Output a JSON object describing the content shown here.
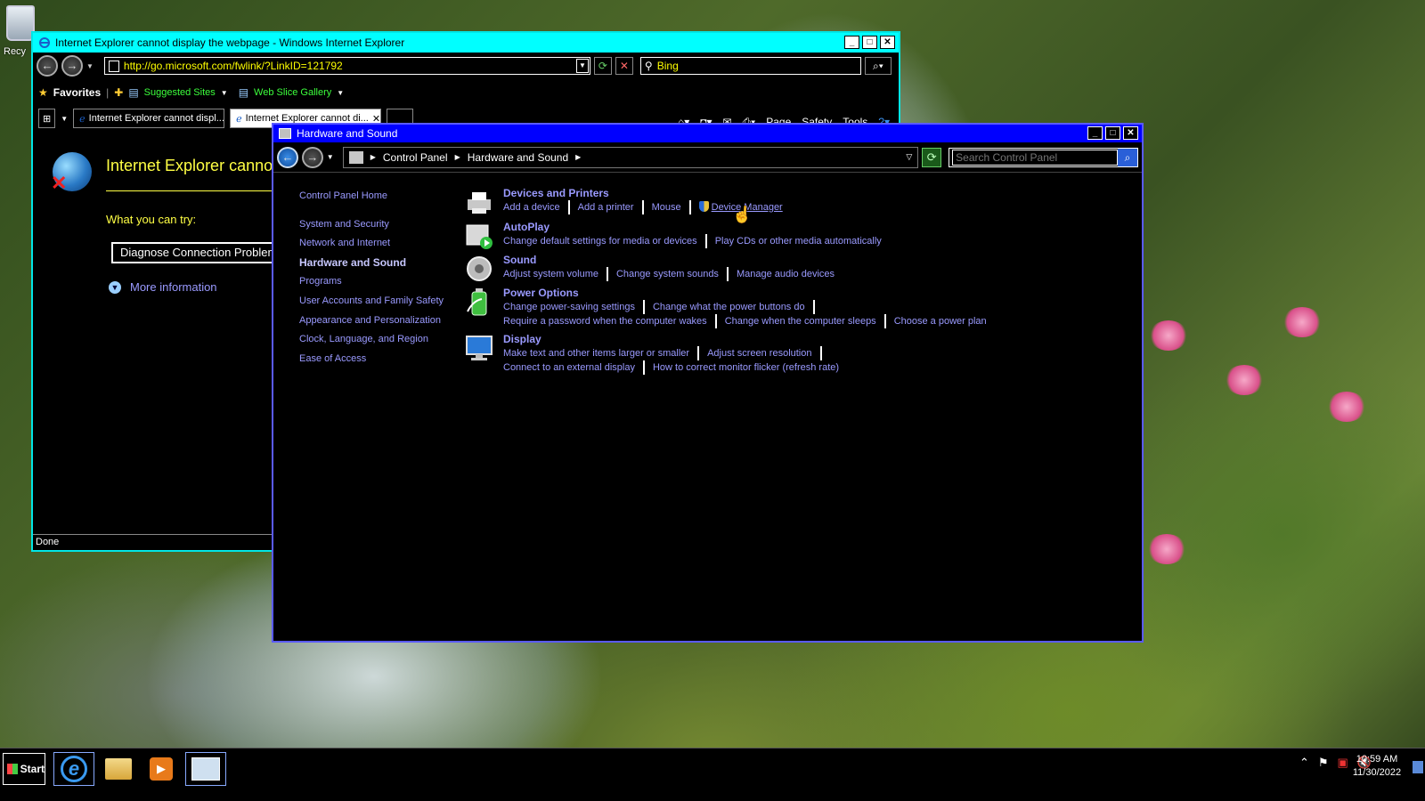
{
  "desktop": {
    "recycle_label": "Recy"
  },
  "ie": {
    "title": "Internet Explorer cannot display the webpage - Windows Internet Explorer",
    "url": "http://go.microsoft.com/fwlink/?LinkID=121792",
    "search_value": "Bing",
    "favorites_label": "Favorites",
    "suggested_sites": "Suggested Sites",
    "web_slice_gallery": "Web Slice Gallery",
    "tabs": [
      {
        "label": "Internet Explorer cannot displ..."
      },
      {
        "label": "Internet Explorer cannot di..."
      }
    ],
    "command_bar": {
      "page": "Page",
      "safety": "Safety",
      "tools": "Tools"
    },
    "content": {
      "heading": "Internet Explorer cannot",
      "what_you_can_try": "What you can try:",
      "diagnose_button": "Diagnose Connection Problem",
      "more_information": "More information"
    },
    "status": "Done"
  },
  "cp": {
    "title": "Hardware and Sound",
    "breadcrumb": [
      "Control Panel",
      "Hardware and Sound"
    ],
    "search_placeholder": "Search Control Panel",
    "nav": {
      "home": "Control Panel Home",
      "items": [
        "System and Security",
        "Network and Internet",
        "Hardware and Sound",
        "Programs",
        "User Accounts and Family Safety",
        "Appearance and Personalization",
        "Clock, Language, and Region",
        "Ease of Access"
      ]
    },
    "categories": [
      {
        "title": "Devices and Printers",
        "icon": "printer-icon",
        "links": [
          "Add a device",
          "Add a printer",
          "Mouse",
          "Device Manager"
        ]
      },
      {
        "title": "AutoPlay",
        "icon": "autoplay-icon",
        "links": [
          "Change default settings for media or devices",
          "Play CDs or other media automatically"
        ]
      },
      {
        "title": "Sound",
        "icon": "speaker-icon",
        "links": [
          "Adjust system volume",
          "Change system sounds",
          "Manage audio devices"
        ]
      },
      {
        "title": "Power Options",
        "icon": "battery-icon",
        "links": [
          "Change power-saving settings",
          "Change what the power buttons do",
          "Require a password when the computer wakes",
          "Change when the computer sleeps",
          "Choose a power plan"
        ]
      },
      {
        "title": "Display",
        "icon": "monitor-icon",
        "links": [
          "Make text and other items larger or smaller",
          "Adjust screen resolution",
          "Connect to an external display",
          "How to correct monitor flicker (refresh rate)"
        ]
      }
    ]
  },
  "taskbar": {
    "start_label": "Start",
    "time": "10:59 AM",
    "date": "11/30/2022"
  },
  "colors": {
    "ie_titlebar": "#00ffff",
    "cp_titlebar": "#0000ff",
    "link": "#9a9aff",
    "ie_text": "#ffff44"
  }
}
